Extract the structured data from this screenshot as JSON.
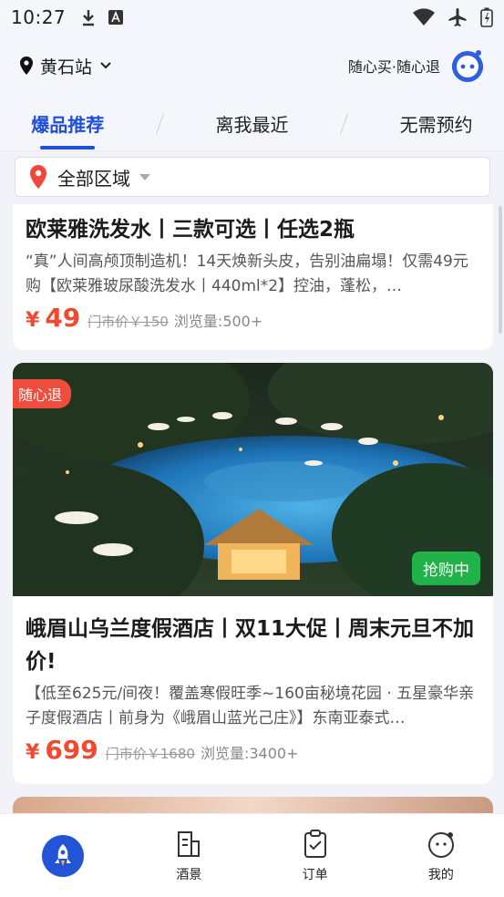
{
  "status_bar": {
    "time": "10:27"
  },
  "header": {
    "location": "黄石站",
    "slogan": "随心买·随心退"
  },
  "tabs": [
    {
      "label": "爆品推荐",
      "active": true
    },
    {
      "label": "离我最近",
      "active": false
    },
    {
      "label": "无需预约",
      "active": false
    }
  ],
  "filter": {
    "label": "全部区域"
  },
  "cards": [
    {
      "title": "欧莱雅洗发水丨三款可选丨任选2瓶",
      "desc": "“真”人间高颅顶制造机！14天焕新头皮，告别油扁塌！仅需49元购【欧莱雅玻尿酸洗发水丨440ml*2】控油，蓬松，…",
      "currency": "¥",
      "price": "49",
      "orig": "门市价￥150",
      "views": "浏览量:500+"
    },
    {
      "badge_left": "随心退",
      "badge_right": "抢购中",
      "title": "峨眉山乌兰度假酒店丨双11大促丨周末元旦不加价!",
      "desc": "【低至625元/间夜！覆盖寒假旺季~160亩秘境花园 · 五星豪华亲子度假酒店丨前身为《峨眉山蓝光己庄》】东南亚泰式…",
      "currency": "¥",
      "price": "699",
      "orig": "门市价￥1680",
      "views": "浏览量:3400+"
    }
  ],
  "bottom_nav": [
    {
      "label": "",
      "icon": "rocket-icon"
    },
    {
      "label": "酒景",
      "icon": "hotel-icon"
    },
    {
      "label": "订单",
      "icon": "order-icon"
    },
    {
      "label": "我的",
      "icon": "profile-icon"
    }
  ],
  "colors": {
    "accent": "#1f4fd8",
    "price": "#f04a2e",
    "badge_red": "#ef4d3d",
    "badge_green": "#21b24a"
  }
}
